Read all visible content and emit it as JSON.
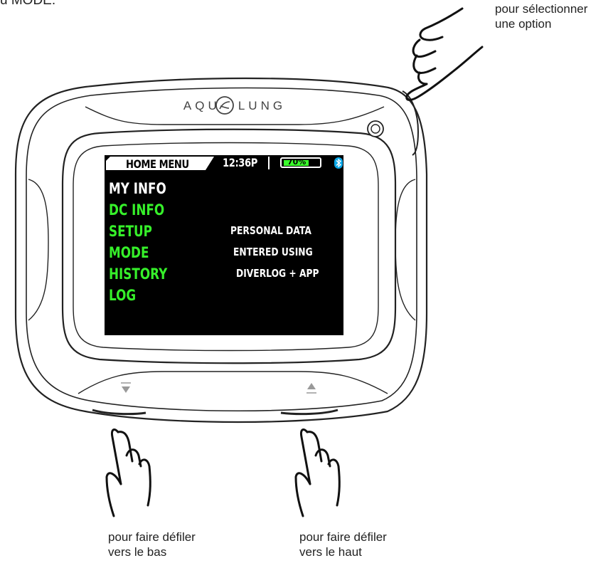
{
  "captions": {
    "top_left": "u MODE.",
    "select": [
      "pour sélectionner",
      "une option"
    ],
    "down": [
      "pour faire défiler",
      "vers le bas"
    ],
    "up": [
      "pour faire défiler",
      "vers le haut"
    ]
  },
  "brand": "AQUA LUNG",
  "screen": {
    "title": "HOME MENU",
    "time": "12:36P",
    "battery_percent": "70%",
    "battery_level": 0.7,
    "menu": [
      {
        "label": "MY INFO",
        "selected": true
      },
      {
        "label": "DC INFO",
        "selected": false
      },
      {
        "label": "SETUP",
        "selected": false
      },
      {
        "label": "MODE",
        "selected": false
      },
      {
        "label": "HISTORY",
        "selected": false
      },
      {
        "label": "LOG",
        "selected": false
      }
    ],
    "info_lines": [
      "PERSONAL DATA",
      "ENTERED USING",
      "DIVERLOG + APP"
    ]
  },
  "colors": {
    "screen_bg": "#000000",
    "menu_selected": "#ffffff",
    "menu_green": "#36f02a",
    "battery_green": "#3aff2b",
    "bluetooth": "#0aa8e8"
  },
  "icons": [
    "select-button-icon",
    "down-triangle-icon",
    "up-triangle-icon",
    "bluetooth-icon",
    "aqualung-logo-icon",
    "pointing-hand-icon"
  ]
}
